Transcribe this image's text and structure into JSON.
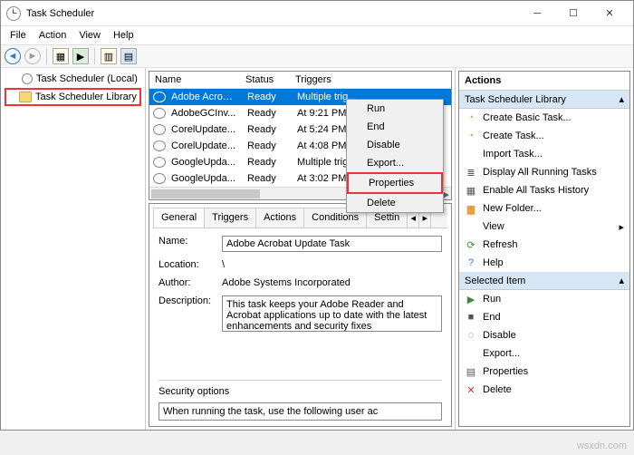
{
  "window": {
    "title": "Task Scheduler"
  },
  "menu": {
    "file": "File",
    "action": "Action",
    "view": "View",
    "help": "Help"
  },
  "tree": {
    "root": "Task Scheduler (Local)",
    "lib": "Task Scheduler Library"
  },
  "cols": {
    "name": "Name",
    "status": "Status",
    "triggers": "Triggers"
  },
  "tasks": [
    {
      "name": "Adobe Acrob...",
      "status": "Ready",
      "trig": "Multiple trig...",
      "sel": true
    },
    {
      "name": "AdobeGCInv...",
      "status": "Ready",
      "trig": "At 9:21 PM e..."
    },
    {
      "name": "CorelUpdate...",
      "status": "Ready",
      "trig": "At 5:24 PM e..."
    },
    {
      "name": "CorelUpdate...",
      "status": "Ready",
      "trig": "At 4:08 PM e..."
    },
    {
      "name": "GoogleUpda...",
      "status": "Ready",
      "trig": "Multiple trig..."
    },
    {
      "name": "GoogleUpda...",
      "status": "Ready",
      "trig": "At 3:02 PM e..."
    }
  ],
  "tabs": {
    "general": "General",
    "triggers": "Triggers",
    "actions": "Actions",
    "conditions": "Conditions",
    "settings": "Settin"
  },
  "form": {
    "name_l": "Name:",
    "name_v": "Adobe Acrobat Update Task",
    "loc_l": "Location:",
    "loc_v": "\\",
    "auth_l": "Author:",
    "auth_v": "Adobe Systems Incorporated",
    "desc_l": "Description:",
    "desc_v": "This task keeps your Adobe Reader and Acrobat applications up to date with the latest enhancements and security fixes",
    "sec_l": "Security options",
    "sec_line": "When running the task, use the following user ac"
  },
  "ctx": {
    "run": "Run",
    "end": "End",
    "disable": "Disable",
    "export": "Export...",
    "properties": "Properties",
    "delete": "Delete"
  },
  "actions": {
    "header": "Actions",
    "sec1": "Task Scheduler Library",
    "create_basic": "Create Basic Task...",
    "create_task": "Create Task...",
    "import": "Import Task...",
    "display_all": "Display All Running Tasks",
    "enable_hist": "Enable All Tasks History",
    "new_folder": "New Folder...",
    "view": "View",
    "refresh": "Refresh",
    "help": "Help",
    "sec2": "Selected Item",
    "run": "Run",
    "end": "End",
    "disable": "Disable",
    "export": "Export...",
    "properties": "Properties",
    "delete": "Delete"
  },
  "watermark": "wsxdn.com"
}
